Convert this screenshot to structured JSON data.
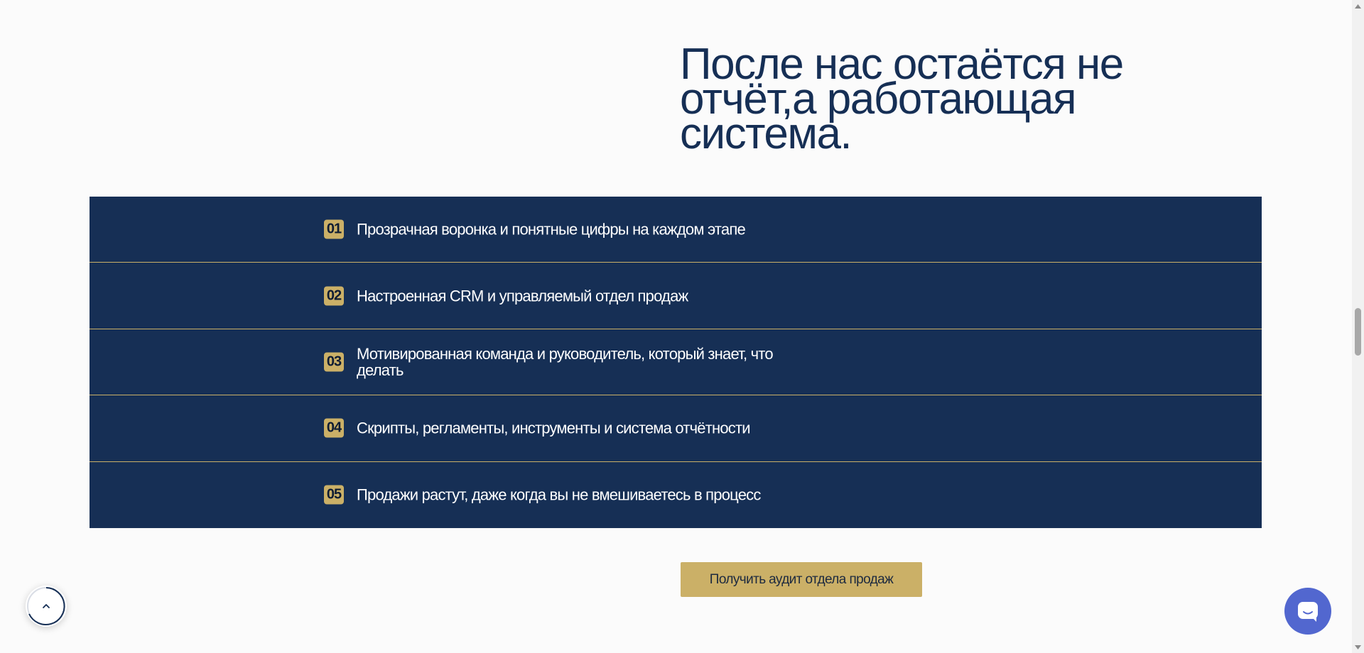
{
  "headline": "После нас остаётся не отчёт,а работающая система.",
  "results": [
    {
      "num": "01",
      "text": "Прозрачная воронка и понятные цифры на каждом этапе"
    },
    {
      "num": "02",
      "text": "Настроенная CRM и управляемый отдел продаж"
    },
    {
      "num": "03",
      "text": "Мотивированная команда и руководитель, который знает, что делать"
    },
    {
      "num": "04",
      "text": "Скрипты, регламенты, инструменты и система отчётности"
    },
    {
      "num": "05",
      "text": "Продажи растут, даже когда вы не вмешиваетесь в процесс"
    }
  ],
  "cta": {
    "label": "Получить аудит отдела продаж"
  },
  "icons": {
    "scroll_top": "chevron-up-icon",
    "chat": "chat-bubble-icon"
  },
  "colors": {
    "navy": "#162f55",
    "gold": "#cbb067",
    "chat_blue": "#5267cf",
    "background": "#fbfbfb"
  }
}
